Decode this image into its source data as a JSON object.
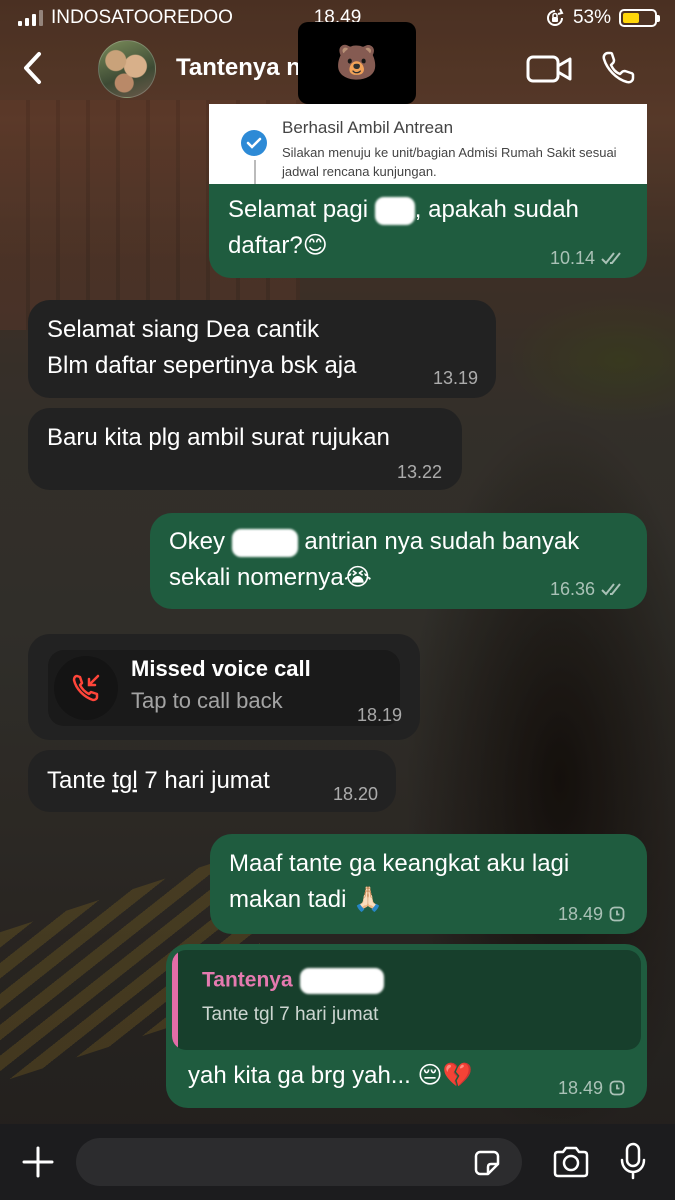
{
  "status_bar": {
    "carrier": "INDOSATOOREDOO",
    "time": "18.49",
    "battery_percent": "53%",
    "battery_level": 0.53
  },
  "header": {
    "contact_name": "Tantenya n",
    "name_cover_emoji": "🐻"
  },
  "attachment": {
    "title": "Berhasil Ambil Antrean",
    "description": "Silakan menuju ke unit/bagian Admisi Rumah Sakit sesuai jadwal rencana kunjungan."
  },
  "messages": [
    {
      "direction": "out",
      "text_a": "Selamat pagi ",
      "text_b": ", apakah sudah daftar?😊",
      "time": "10.14",
      "status": "read"
    },
    {
      "direction": "in",
      "text": "Selamat siang Dea cantik\nBlm daftar sepertinya bsk aja",
      "time": "13.19"
    },
    {
      "direction": "in",
      "text": "Baru kita plg ambil surat rujukan",
      "time": "13.22"
    },
    {
      "direction": "out",
      "text_a": "Okey ",
      "text_b": " antrian nya sudah banyak sekali nomernya😭",
      "time": "16.36",
      "status": "read"
    },
    {
      "direction": "in",
      "text_a": "Tante ",
      "text_b": "tgl",
      "text_c": " 7 hari jumat",
      "time": "18.20"
    },
    {
      "direction": "out",
      "text": "Maaf tante ga keangkat aku lagi makan tadi 🙏🏻",
      "time": "18.49",
      "status": "pending"
    },
    {
      "direction": "out",
      "text": "yah kita ga brg yah... 😔💔",
      "time": "18.49",
      "status": "pending"
    }
  ],
  "missed_call": {
    "title": "Missed voice call",
    "subtitle": "Tap to call back",
    "time": "18.19"
  },
  "reply_quote": {
    "name": "Tantenya",
    "text": "Tante tgl 7 hari jumat"
  },
  "composer": {
    "placeholder": ""
  },
  "colors": {
    "outgoing_bubble": "#1f5c3f",
    "incoming_bubble": "#222222",
    "quote_accent": "#e26da7",
    "missed_call_red": "#ff453a",
    "battery_yellow": "#ffd60a"
  },
  "icons": [
    "back-chevron-icon",
    "video-call-icon",
    "phone-icon",
    "check-circle-icon",
    "double-tick-icon",
    "clock-icon",
    "missed-call-icon",
    "plus-icon",
    "sticker-icon",
    "camera-icon",
    "microphone-icon"
  ]
}
